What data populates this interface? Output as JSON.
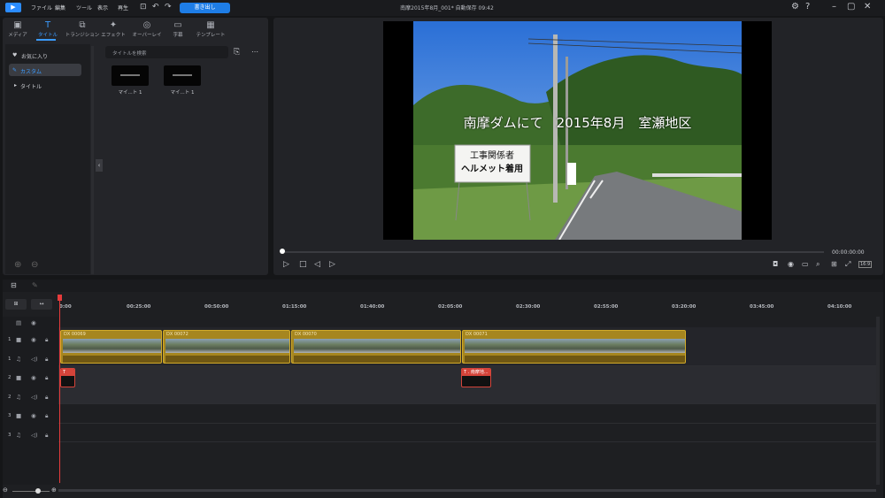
{
  "menu": {
    "items": [
      "ファイル",
      "編集",
      "ツール",
      "表示",
      "再生"
    ],
    "export_label": "書き出し"
  },
  "window": {
    "title": "南摩2015年8月_001* 自動保存 09:42"
  },
  "tabs": [
    {
      "label": "メディア",
      "icon": "media-icon"
    },
    {
      "label": "タイトル",
      "icon": "title-icon",
      "active": true
    },
    {
      "label": "トランジション",
      "icon": "transition-icon"
    },
    {
      "label": "エフェクト",
      "icon": "effect-icon"
    },
    {
      "label": "オーバーレイ",
      "icon": "overlay-icon"
    },
    {
      "label": "字幕",
      "icon": "subtitle-icon"
    },
    {
      "label": "テンプレート",
      "icon": "template-icon"
    }
  ],
  "sidebar": {
    "items": [
      "お気に入り",
      "カスタム",
      "タイトル"
    ]
  },
  "search": {
    "placeholder": "タイトルを検索"
  },
  "thumbs": [
    "マイ...ト 1",
    "マイ...ト 1"
  ],
  "preview": {
    "caption": "南摩ダムにて　2015年8月　室瀬地区",
    "sign_line1": "工事関係者",
    "sign_line2": "ヘルメット着用",
    "timecode": "00:00:00:00",
    "ratio": "16:9"
  },
  "timeline": {
    "start": "0:00",
    "ticks": [
      "00:25:00",
      "00:50:00",
      "01:15:00",
      "01:40:00",
      "02:05:00",
      "02:30:00",
      "02:55:00",
      "03:20:00",
      "03:45:00",
      "04:10:00"
    ],
    "tracks": [
      "1",
      "1",
      "2",
      "2",
      "3",
      "3"
    ],
    "video_clips": [
      "DX 00069",
      "DX 00072",
      "DX 00070",
      "DX 00071"
    ],
    "title_clips": [
      "",
      ". 南摩地..."
    ]
  }
}
